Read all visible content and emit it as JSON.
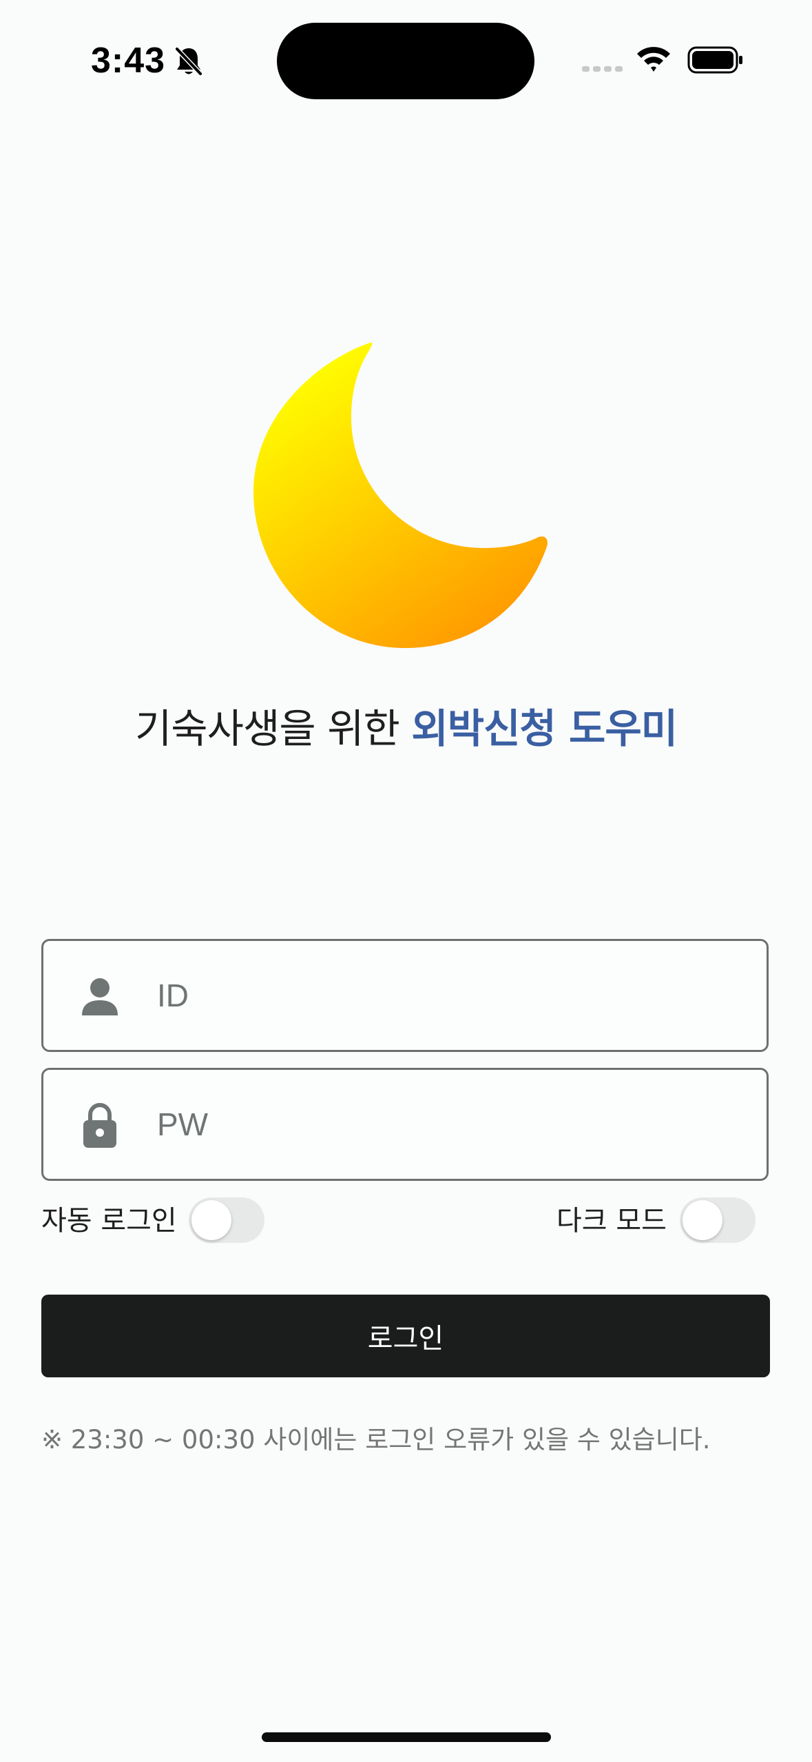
{
  "status_bar": {
    "time": "3:43",
    "icons": [
      "bell-slash-icon",
      "cellular-signal-icon",
      "wifi-icon",
      "battery-icon"
    ]
  },
  "logo": {
    "icon": "crescent-moon-icon",
    "colors": {
      "top": "#ffff00",
      "bottom": "#ff9a00"
    }
  },
  "tagline": {
    "prefix": "기숙사생을 위한 ",
    "accent": "외박신청 도우미",
    "accent_color": "#3a5fa2"
  },
  "form": {
    "id_field": {
      "placeholder": "ID",
      "value": "",
      "icon": "person-icon"
    },
    "pw_field": {
      "placeholder": "PW",
      "value": "",
      "icon": "lock-icon"
    },
    "auto_login": {
      "label": "자동 로그인",
      "on": false
    },
    "dark_mode": {
      "label": "다크 모드",
      "on": false
    },
    "login_button_label": "로그인"
  },
  "notice": "※ 23:30 ~ 00:30 사이에는 로그인 오류가 있을 수 있습니다."
}
